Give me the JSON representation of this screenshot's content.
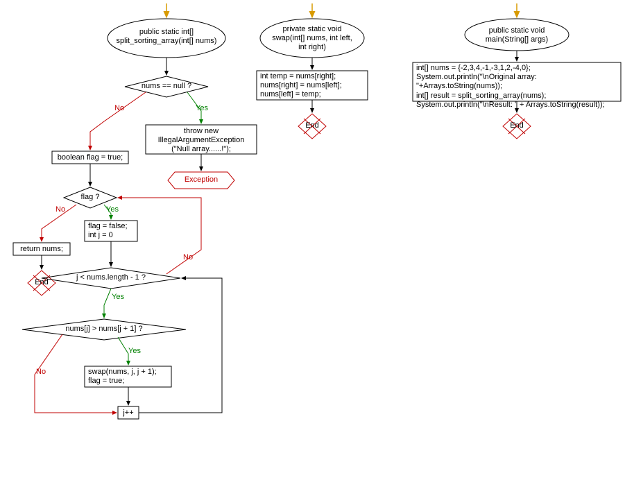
{
  "flow1": {
    "start": "public static int[] split_sorting_array(int[] nums)",
    "cond_null": "nums == null ?",
    "throw": "throw new IllegalArgumentException (\"Null array......!\");",
    "exception": "Exception",
    "flag_true": "boolean flag = true;",
    "cond_flag": "flag ?",
    "return": "return nums;",
    "end1": "End",
    "flag_false": "flag = false;\nint j = 0",
    "cond_j": "j < nums.length - 1 ?",
    "cond_nums": "nums[j] > nums[j + 1] ?",
    "swap_call": "swap(nums, j, j + 1);\nflag = true;",
    "jpp": "j++"
  },
  "flow2": {
    "start": "private static void swap(int[] nums, int left, int right)",
    "body": "int temp = nums[right];\nnums[right] = nums[left];\nnums[left] = temp;",
    "end": "End"
  },
  "flow3": {
    "start": "public static void main(String[] args)",
    "body": "int[] nums = {-2,3,4,-1,-3,1,2,-4,0};\nSystem.out.println(\"\\nOriginal array: \"+Arrays.toString(nums));\nint[] result = split_sorting_array(nums);\nSystem.out.println(\"\\nResult: \" + Arrays.toString(result));",
    "end": "End"
  },
  "labels": {
    "yes": "Yes",
    "no": "No"
  }
}
